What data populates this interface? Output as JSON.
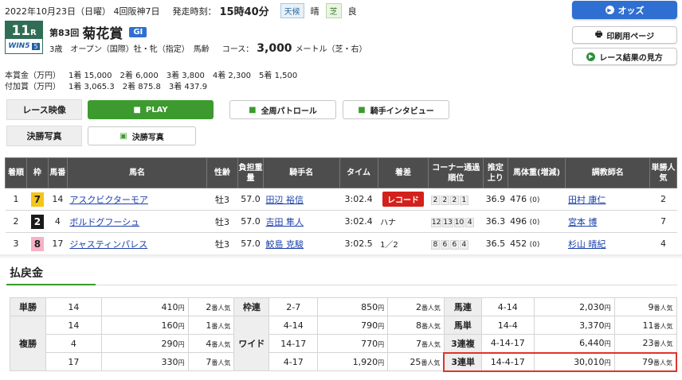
{
  "header": {
    "date_line": "2022年10月23日（日曜） 4回阪神7日",
    "start_label": "発走時刻：",
    "start_time": "15時40分",
    "weather_label": "天候",
    "weather_value": "晴",
    "track_label": "芝",
    "track_value": "良"
  },
  "race": {
    "race_no": "11",
    "race_suffix": "R",
    "logo": "WIN5",
    "logo_num": "5",
    "edition": "第83回",
    "name": "菊花賞",
    "grade": "GI",
    "conditions": "3歳　オープン（国際）牡・牝（指定）　馬齢",
    "course_label": "コース：",
    "course_distance": "3,000",
    "course_unit": "メートル（芝・右）"
  },
  "prize": {
    "main_label": "本賞金（万円）",
    "main": [
      "1着 15,000",
      "2着 6,000",
      "3着 3,800",
      "4着 2,300",
      "5着 1,500"
    ],
    "add_label": "付加賞（万円）",
    "add": [
      "1着 3,065.3",
      "2着 875.8",
      "3着 437.9"
    ]
  },
  "side_buttons": {
    "odds": "オッズ",
    "print": "印刷用ページ",
    "results_guide": "レース結果の見方"
  },
  "media": {
    "video_label": "レース映像",
    "play": "PLAY",
    "patrol": "全周パトロール",
    "interview": "騎手インタビュー",
    "photo_label": "決勝写真",
    "photo_btn": "決勝写真"
  },
  "results": {
    "headers": [
      "着順",
      "枠",
      "馬番",
      "馬名",
      "性齢",
      "負担重量",
      "騎手名",
      "タイム",
      "着差",
      "コーナー通過順位",
      "推定上り",
      "馬体重(増減)",
      "調教師名",
      "単勝人気"
    ],
    "rows": [
      {
        "rank": "1",
        "waku": "7",
        "umaban": "14",
        "horse": "アスクビクターモア",
        "sex_age": "牡3",
        "weight": "57.0",
        "jockey": "田辺 裕信",
        "time": "3:02.4",
        "margin": "レコード",
        "corners": [
          "2",
          "2",
          "2",
          "1"
        ],
        "last3f": "36.9",
        "body": "476",
        "body_diff": "(0)",
        "trainer": "田村 康仁",
        "pop": "2"
      },
      {
        "rank": "2",
        "waku": "2",
        "umaban": "4",
        "horse": "ボルドグフーシュ",
        "sex_age": "牡3",
        "weight": "57.0",
        "jockey": "吉田 隼人",
        "time": "3:02.4",
        "margin": "ハナ",
        "corners": [
          "12",
          "13",
          "10",
          "4"
        ],
        "last3f": "36.3",
        "body": "496",
        "body_diff": "(0)",
        "trainer": "宮本 博",
        "pop": "7"
      },
      {
        "rank": "3",
        "waku": "8",
        "umaban": "17",
        "horse": "ジャスティンパレス",
        "sex_age": "牡3",
        "weight": "57.0",
        "jockey": "鮫島 克駿",
        "time": "3:02.5",
        "margin": "1／2",
        "corners": [
          "8",
          "6",
          "6",
          "4"
        ],
        "last3f": "36.5",
        "body": "452",
        "body_diff": "(0)",
        "trainer": "杉山 晴紀",
        "pop": "4"
      }
    ]
  },
  "payout": {
    "title": "払戻金",
    "yen": "円",
    "pop_suffix": "番人気",
    "tansho": {
      "label": "単勝",
      "num": "14",
      "amount": "410",
      "pop": "2"
    },
    "fukusho": {
      "label": "複勝",
      "rows": [
        {
          "num": "14",
          "amount": "160",
          "pop": "1"
        },
        {
          "num": "4",
          "amount": "290",
          "pop": "4"
        },
        {
          "num": "17",
          "amount": "330",
          "pop": "7"
        }
      ]
    },
    "wakuren": {
      "label": "枠連",
      "num": "2-7",
      "amount": "850",
      "pop": "2"
    },
    "wide": {
      "label": "ワイド",
      "rows": [
        {
          "num": "4-14",
          "amount": "790",
          "pop": "8"
        },
        {
          "num": "14-17",
          "amount": "770",
          "pop": "7"
        },
        {
          "num": "4-17",
          "amount": "1,920",
          "pop": "25"
        }
      ]
    },
    "umaren": {
      "label": "馬連",
      "num": "4-14",
      "amount": "2,030",
      "pop": "9"
    },
    "umatan": {
      "label": "馬単",
      "num": "14-4",
      "amount": "3,370",
      "pop": "11"
    },
    "sanrenpuku": {
      "label": "3連複",
      "num": "4-14-17",
      "amount": "6,440",
      "pop": "23"
    },
    "sanrentan": {
      "label": "3連単",
      "num": "14-4-17",
      "amount": "30,010",
      "pop": "79"
    }
  },
  "colors": {
    "waku7": "#f5c518",
    "waku2": "#1a1a1a",
    "waku8": "#f6b3c6",
    "record_red": "#d4201b",
    "highlight_red": "#e0332b",
    "play_green": "#3c9a2e"
  }
}
